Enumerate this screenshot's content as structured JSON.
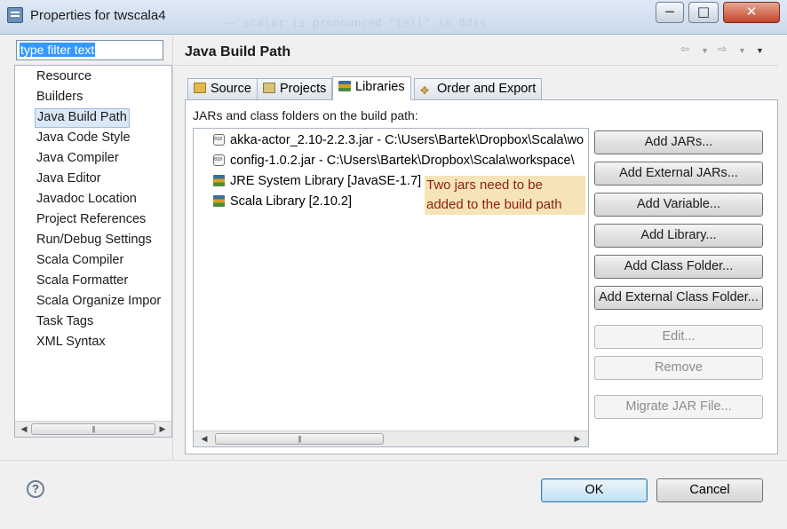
{
  "window": {
    "title": "Properties for twscala4",
    "minimize": "−",
    "maximize": "□",
    "close": "✕",
    "background_text": "-- scalar is pronounced \"tell\" in ddss"
  },
  "filter": {
    "value": "type filter text"
  },
  "nav_items": [
    "Resource",
    "Builders",
    "Java Build Path",
    "Java Code Style",
    "Java Compiler",
    "Java Editor",
    "Javadoc Location",
    "Project References",
    "Run/Debug Settings",
    "Scala Compiler",
    "Scala Formatter",
    "Scala Organize Impor",
    "Task Tags",
    "XML Syntax"
  ],
  "selected_nav": "Java Build Path",
  "page": {
    "title": "Java Build Path",
    "tabs": [
      {
        "label": "Source",
        "icon": "source-folder-icon"
      },
      {
        "label": "Projects",
        "icon": "projects-icon"
      },
      {
        "label": "Libraries",
        "icon": "libraries-icon",
        "active": true
      },
      {
        "label": "Order and Export",
        "icon": "order-export-icon"
      }
    ],
    "list_label": "JARs and class folders on the build path:",
    "entries": [
      {
        "icon": "jar-icon",
        "text": "akka-actor_2.10-2.2.3.jar - C:\\Users\\Bartek\\Dropbox\\Scala\\wo"
      },
      {
        "icon": "jar-icon",
        "text": "config-1.0.2.jar - C:\\Users\\Bartek\\Dropbox\\Scala\\workspace\\"
      },
      {
        "icon": "library-icon",
        "text": "JRE System Library [JavaSE-1.7]"
      },
      {
        "icon": "library-icon",
        "text": "Scala Library [2.10.2]"
      }
    ],
    "note": {
      "line1": "Two jars need to be",
      "line2": "added to the build path"
    },
    "buttons": {
      "add_jars": "Add JARs...",
      "add_external_jars": "Add External JARs...",
      "add_variable": "Add Variable...",
      "add_library": "Add Library...",
      "add_class_folder": "Add Class Folder...",
      "add_external_class_folder": "Add External Class Folder...",
      "edit": "Edit...",
      "remove": "Remove",
      "migrate_jar": "Migrate JAR File..."
    }
  },
  "dialog": {
    "help": "?",
    "ok": "OK",
    "cancel": "Cancel"
  },
  "colors": {
    "note_bg": "#f5e4b7",
    "note_text": "#8b1e12",
    "selection": "#3399ff"
  }
}
